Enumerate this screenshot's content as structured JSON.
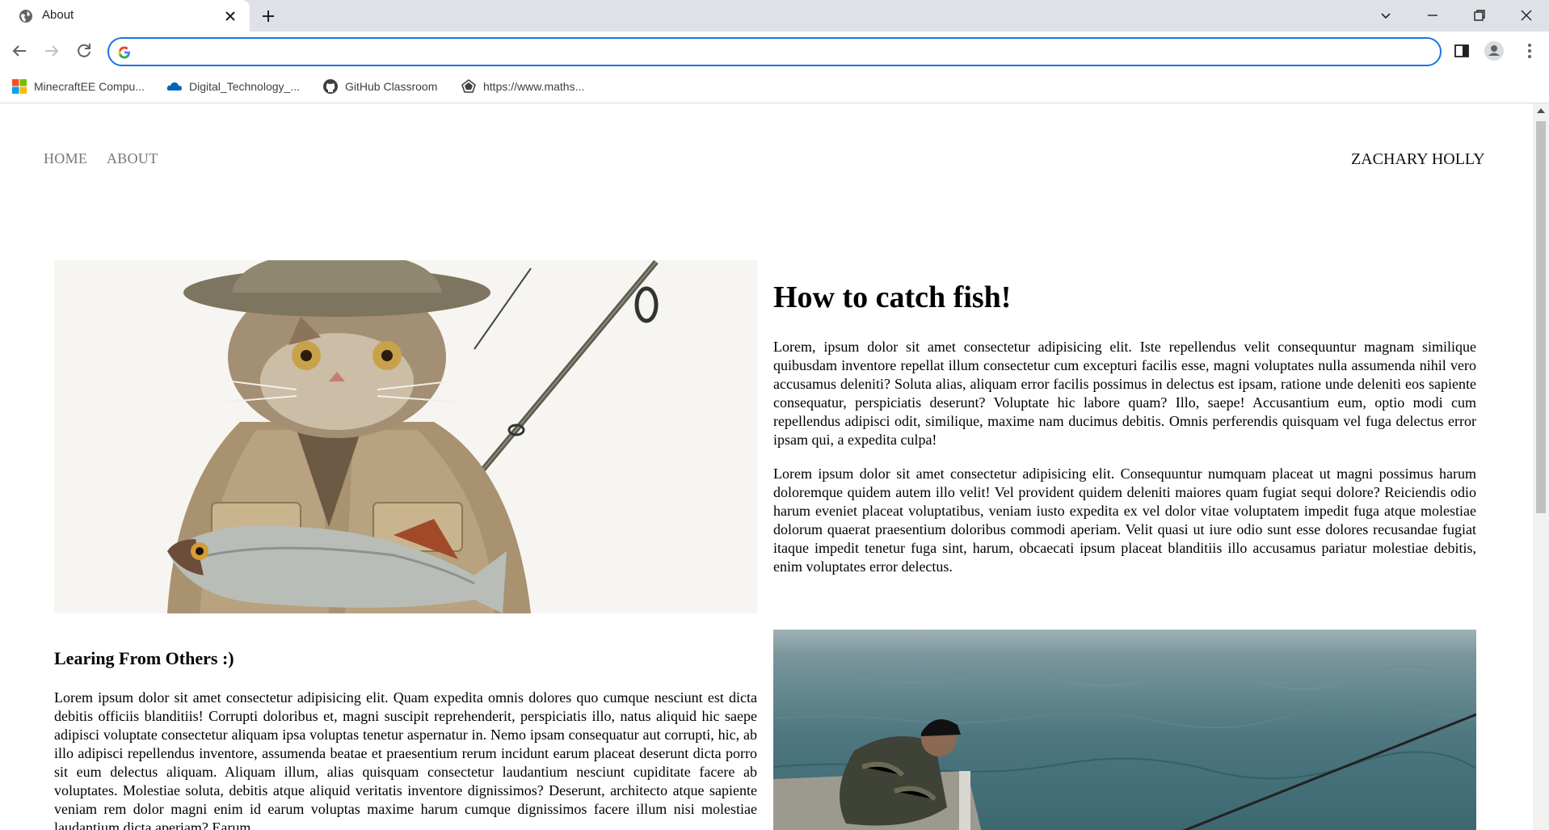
{
  "browser": {
    "tab_title": "About",
    "omnibox_value": "",
    "bookmarks": [
      {
        "label": "MinecraftEE Compu...",
        "icon": "windows-icon"
      },
      {
        "label": "Digital_Technology_...",
        "icon": "onedrive-icon"
      },
      {
        "label": "GitHub Classroom",
        "icon": "github-icon"
      },
      {
        "label": "https://www.maths...",
        "icon": "pentagon-icon"
      }
    ]
  },
  "site": {
    "nav": [
      "HOME",
      "ABOUT"
    ],
    "name": "ZACHARY HOLLY"
  },
  "main": {
    "heading": "How to catch fish!",
    "p1": "Lorem, ipsum dolor sit amet consectetur adipisicing elit. Iste repellendus velit consequuntur magnam similique quibusdam inventore repellat illum consectetur cum excepturi facilis esse, magni voluptates nulla assumenda nihil vero accusamus deleniti? Soluta alias, aliquam error facilis possimus in delectus est ipsam, ratione unde deleniti eos sapiente consequatur, perspiciatis deserunt? Voluptate hic labore quam? Illo, saepe! Accusantium eum, optio modi cum repellendus adipisci odit, similique, maxime nam ducimus debitis. Omnis perferendis quisquam vel fuga delectus error ipsam qui, a expedita culpa!",
    "p2": "Lorem ipsum dolor sit amet consectetur adipisicing elit. Consequuntur numquam placeat ut magni possimus harum doloremque quidem autem illo velit! Vel provident quidem deleniti maiores quam fugiat sequi dolore? Reiciendis odio harum eveniet placeat voluptatibus, veniam iusto expedita ex vel dolor vitae voluptatem impedit fuga atque molestiae dolorum quaerat praesentium doloribus commodi aperiam. Velit quasi ut iure odio sunt esse dolores recusandae fugiat itaque impedit tenetur fuga sint, harum, obcaecati ipsum placeat blanditiis illo accusamus pariatur molestiae debitis, enim voluptates error delectus."
  },
  "second": {
    "heading": "Learing From Others :)",
    "p1": "Lorem ipsum dolor sit amet consectetur adipisicing elit. Quam expedita omnis dolores quo cumque nesciunt est dicta debitis officiis blanditiis! Corrupti doloribus et, magni suscipit reprehenderit, perspiciatis illo, natus aliquid hic saepe adipisci voluptate consectetur aliquam ipsa voluptas tenetur aspernatur in. Nemo ipsam consequatur aut corrupti, hic, ab illo adipisci repellendus inventore, assumenda beatae et praesentium rerum incidunt earum placeat deserunt dicta porro sit eum delectus aliquam. Aliquam illum, alias quisquam consectetur laudantium nesciunt cupiditate facere ab voluptates. Molestiae soluta, debitis atque aliquid veritatis inventore dignissimos? Deserunt, architecto atque sapiente veniam rem dolor magni enim id earum voluptas maxime harum cumque dignissimos facere illum nisi molestiae laudantium dicta aperiam? Earum"
  },
  "colors": {
    "accent": "#1a73e8",
    "nav_link": "#777777",
    "tabstrip": "#dee1e6"
  }
}
